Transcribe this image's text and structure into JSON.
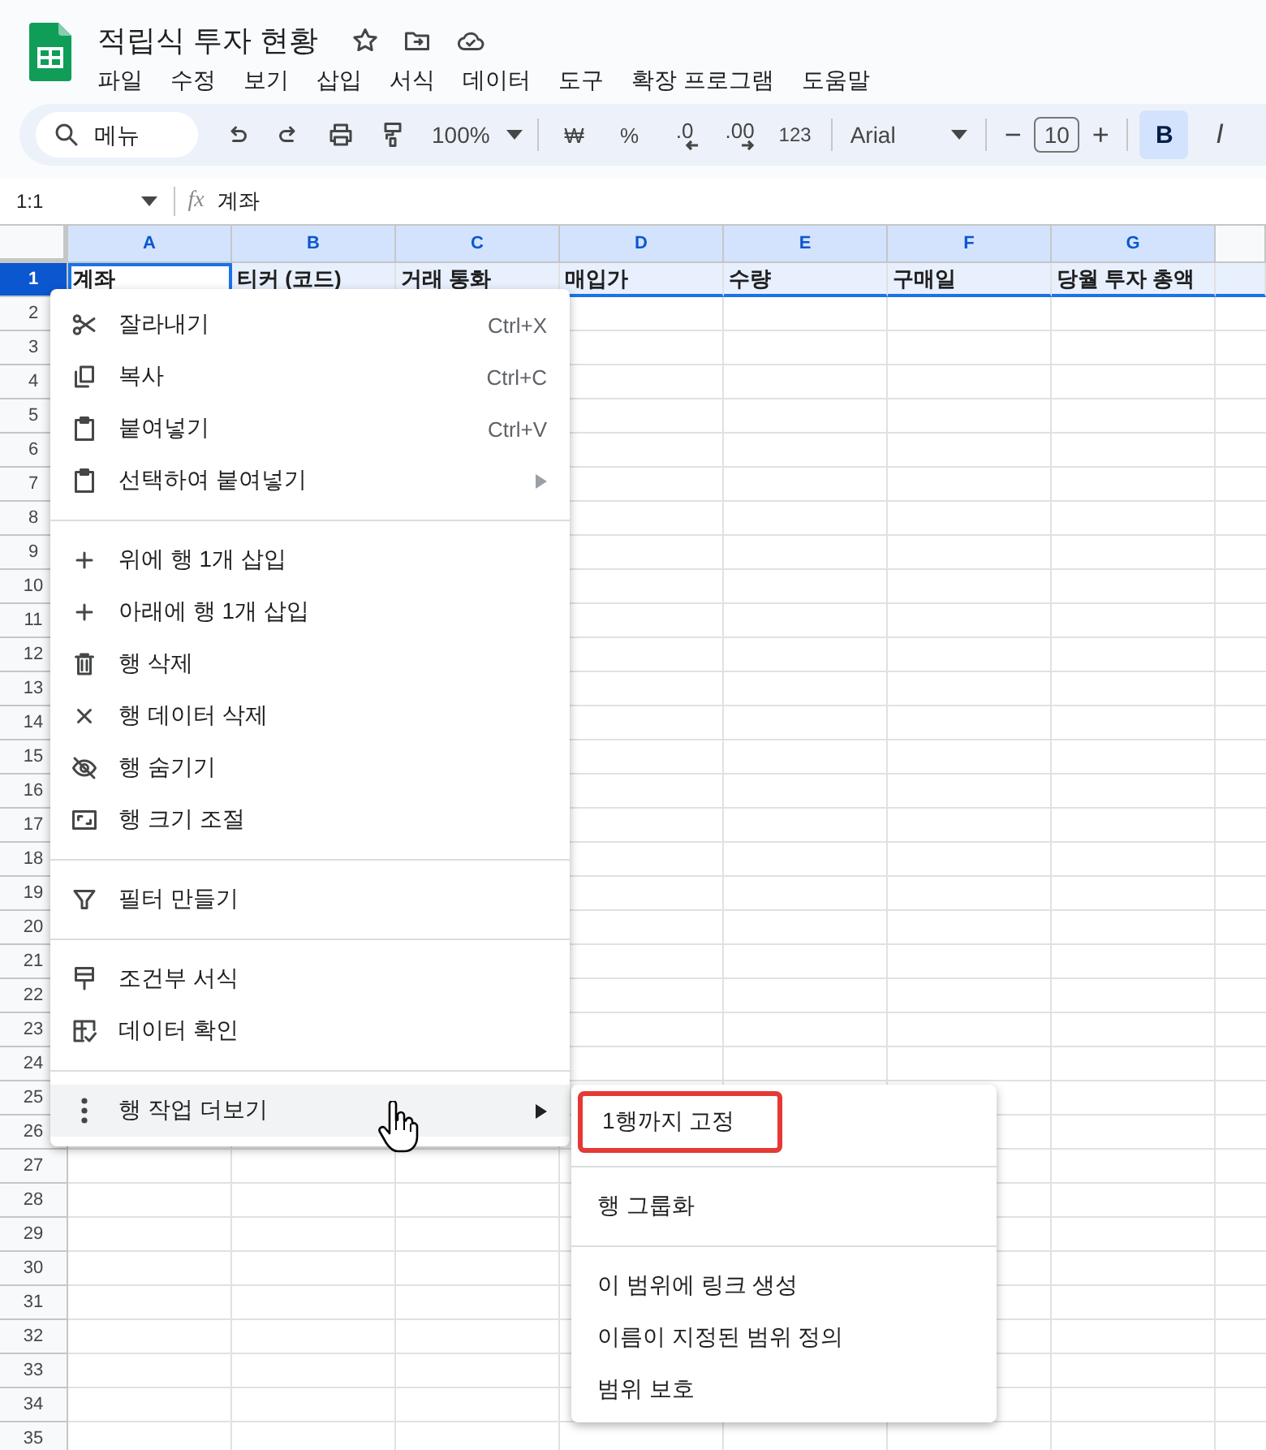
{
  "document": {
    "title": "적립식 투자 현황"
  },
  "menu_bar": [
    {
      "label": "파일"
    },
    {
      "label": "수정"
    },
    {
      "label": "보기"
    },
    {
      "label": "삽입"
    },
    {
      "label": "서식"
    },
    {
      "label": "데이터"
    },
    {
      "label": "도구"
    },
    {
      "label": "확장 프로그램"
    },
    {
      "label": "도움말"
    }
  ],
  "toolbar": {
    "search": {
      "placeholder": "메뉴"
    },
    "zoom": "100%",
    "format_buttons": [
      {
        "label": "₩"
      },
      {
        "label": "%"
      },
      {
        "label": ".0"
      },
      {
        "label": ".00"
      },
      {
        "label": "123"
      }
    ],
    "font": "Arial",
    "size_minus": "−",
    "font_size": "10",
    "size_plus": "+",
    "style_buttons": [
      {
        "label": "B",
        "selected": true
      },
      {
        "label": "I",
        "selected": false
      }
    ]
  },
  "formula_bar": {
    "cell_reference": "1:1",
    "fx": "fx",
    "value": "계좌"
  },
  "grid": {
    "columns": [
      {
        "label": "A",
        "highlighted": true
      },
      {
        "label": "B",
        "highlighted": true
      },
      {
        "label": "C",
        "highlighted": true
      },
      {
        "label": "D",
        "highlighted": true
      },
      {
        "label": "E",
        "highlighted": true
      },
      {
        "label": "F",
        "highlighted": true
      },
      {
        "label": "G",
        "highlighted": true
      }
    ],
    "rows": [
      {
        "number": "1",
        "selected": true,
        "cells": [
          "계좌",
          "티커 (코드)",
          "거래 통화",
          "매입가",
          "수량",
          "구매일",
          "당월 투자 총액"
        ]
      },
      {
        "number": "2",
        "selected": false
      },
      {
        "number": "3",
        "selected": false
      },
      {
        "number": "4",
        "selected": false
      },
      {
        "number": "5",
        "selected": false
      },
      {
        "number": "6",
        "selected": false
      },
      {
        "number": "7",
        "selected": false
      },
      {
        "number": "8",
        "selected": false
      },
      {
        "number": "9",
        "selected": false
      },
      {
        "number": "10",
        "selected": false
      },
      {
        "number": "11",
        "selected": false
      },
      {
        "number": "12",
        "selected": false
      },
      {
        "number": "13",
        "selected": false
      },
      {
        "number": "14",
        "selected": false
      },
      {
        "number": "15",
        "selected": false
      },
      {
        "number": "16",
        "selected": false
      },
      {
        "number": "17",
        "selected": false
      },
      {
        "number": "18",
        "selected": false
      },
      {
        "number": "19",
        "selected": false
      },
      {
        "number": "20",
        "selected": false
      },
      {
        "number": "21",
        "selected": false
      },
      {
        "number": "22",
        "selected": false
      },
      {
        "number": "23",
        "selected": false
      },
      {
        "number": "24",
        "selected": false
      },
      {
        "number": "25",
        "selected": false
      },
      {
        "number": "26",
        "selected": false
      },
      {
        "number": "27",
        "selected": false
      },
      {
        "number": "28",
        "selected": false
      },
      {
        "number": "29",
        "selected": false
      },
      {
        "number": "30",
        "selected": false
      },
      {
        "number": "31",
        "selected": false
      },
      {
        "number": "32",
        "selected": false
      },
      {
        "number": "33",
        "selected": false
      },
      {
        "number": "34",
        "selected": false
      },
      {
        "number": "35",
        "selected": false
      }
    ]
  },
  "context_menu": {
    "items": [
      {
        "kind": "item",
        "label": "잘라내기",
        "shortcut": "Ctrl+X",
        "selected": false,
        "submenu": false
      },
      {
        "kind": "item",
        "label": "복사",
        "shortcut": "Ctrl+C",
        "selected": false,
        "submenu": false
      },
      {
        "kind": "item",
        "label": "붙여넣기",
        "shortcut": "Ctrl+V",
        "selected": false,
        "submenu": false
      },
      {
        "kind": "item",
        "label": "선택하여 붙여넣기",
        "selected": false,
        "submenu": true
      },
      {
        "kind": "divider"
      },
      {
        "kind": "item",
        "label": "위에 행 1개 삽입",
        "selected": false,
        "submenu": false
      },
      {
        "kind": "item",
        "label": "아래에 행 1개 삽입",
        "selected": false,
        "submenu": false
      },
      {
        "kind": "item",
        "label": "행 삭제",
        "selected": false,
        "submenu": false
      },
      {
        "kind": "item",
        "label": "행 데이터 삭제",
        "selected": false,
        "submenu": false
      },
      {
        "kind": "item",
        "label": "행 숨기기",
        "selected": false,
        "submenu": false
      },
      {
        "kind": "item",
        "label": "행 크기 조절",
        "selected": false,
        "submenu": false
      },
      {
        "kind": "divider"
      },
      {
        "kind": "item",
        "label": "필터 만들기",
        "selected": false,
        "submenu": false
      },
      {
        "kind": "divider"
      },
      {
        "kind": "item",
        "label": "조건부 서식",
        "selected": false,
        "submenu": false
      },
      {
        "kind": "item",
        "label": "데이터 확인",
        "selected": false,
        "submenu": false
      },
      {
        "kind": "divider"
      },
      {
        "kind": "item",
        "label": "행 작업 더보기",
        "selected": true,
        "submenu": true
      }
    ]
  },
  "submenu": {
    "items": [
      {
        "kind": "item",
        "label": "1행까지 고정",
        "highlighted": true
      },
      {
        "kind": "divider"
      },
      {
        "kind": "item",
        "label": "행 그룹화",
        "highlighted": false
      },
      {
        "kind": "divider"
      },
      {
        "kind": "item",
        "label": "이 범위에 링크 생성",
        "highlighted": false
      },
      {
        "kind": "item",
        "label": "이름이 지정된 범위 정의",
        "highlighted": false
      },
      {
        "kind": "item",
        "label": "범위 보호",
        "highlighted": false
      }
    ]
  }
}
